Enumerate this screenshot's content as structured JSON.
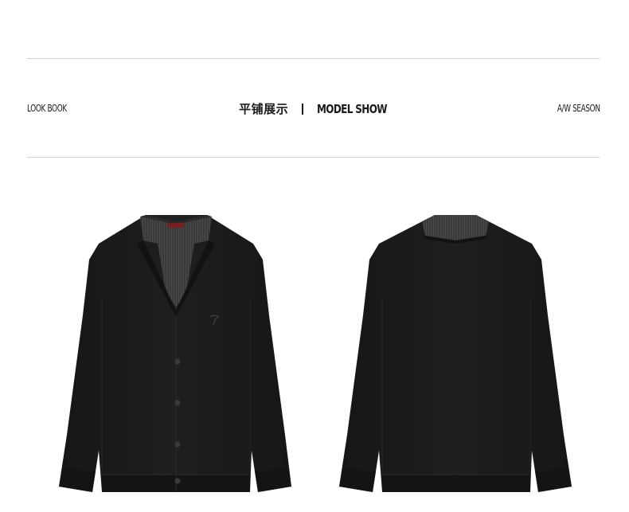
{
  "header": {
    "left_label": "LOOK BOOK",
    "cn_title": "平铺展示",
    "en_title": "MODEL SHOW",
    "right_label": "A/W SEASON"
  },
  "colors": {
    "rule": "#d3d3d3",
    "text": "#1a1a1a",
    "knit": "#1b1b1b",
    "shirt": "#3c3c3c",
    "button": "#2a2a2a"
  },
  "products": [
    {
      "view": "front",
      "item": "cardigan-with-shirt-collar"
    },
    {
      "view": "back",
      "item": "cardigan-with-shirt-collar"
    }
  ]
}
